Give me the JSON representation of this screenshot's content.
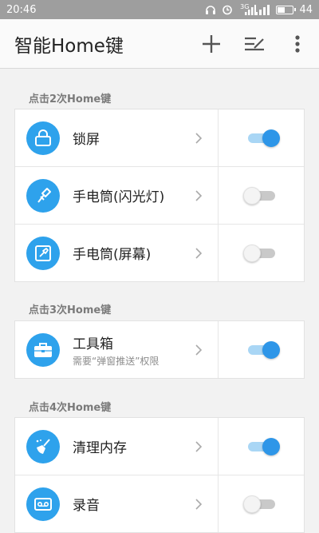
{
  "status_bar": {
    "time": "20:46",
    "signal1": "3G",
    "battery_level": "44"
  },
  "app_bar": {
    "title": "智能Home键",
    "icons": [
      "add-icon",
      "edit-list-icon",
      "more-vert-icon"
    ]
  },
  "sections": [
    {
      "header": "点击2次Home键"
    },
    {
      "header": "点击3次Home键"
    },
    {
      "header": "点击4次Home键"
    }
  ],
  "items": [
    {
      "label": "锁屏",
      "icon": "lock-icon",
      "enabled": true
    },
    {
      "label": "手电筒(闪光灯)",
      "icon": "flashlight-icon",
      "enabled": false
    },
    {
      "label": "手电筒(屏幕)",
      "icon": "screen-light-icon",
      "enabled": false
    },
    {
      "label": "工具箱",
      "sub": "需要“弹窗推送”权限",
      "icon": "toolbox-icon",
      "enabled": true
    },
    {
      "label": "清理内存",
      "icon": "broom-icon",
      "enabled": true
    },
    {
      "label": "录音",
      "icon": "recorder-icon",
      "enabled": false
    }
  ],
  "colors": {
    "accent": "#2ea2ec",
    "switch_on": "#2e96e8",
    "switch_on_track": "#a9d6f5"
  }
}
